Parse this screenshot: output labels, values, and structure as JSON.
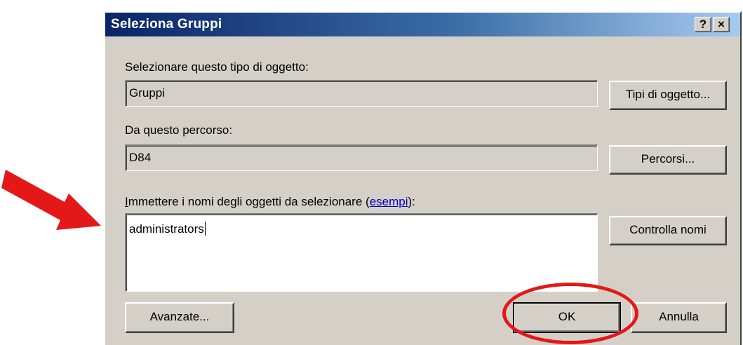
{
  "dialog": {
    "title": "Seleziona Gruppi",
    "help_symbol": "?",
    "close_symbol": "×",
    "object_type": {
      "label": "Selezionare questo tipo di oggetto:",
      "value": "Gruppi",
      "button": "Tipi di oggetto..."
    },
    "location": {
      "label": "Da questo percorso:",
      "value": "D84",
      "button": "Percorsi..."
    },
    "names": {
      "label_access_key": "I",
      "label_before_link": "mmettere i nomi degli oggetti da selezionare (",
      "link_text": "esempi",
      "label_after_link": "):",
      "value": "administrators",
      "button": "Controlla nomi"
    },
    "buttons": {
      "advanced": "Avanzate...",
      "ok": "OK",
      "cancel": "Annulla"
    }
  },
  "annotations": {
    "color": "#e41818",
    "arrow_icon": "red-arrow-icon",
    "highlight": "red-ellipse-around-ok"
  }
}
